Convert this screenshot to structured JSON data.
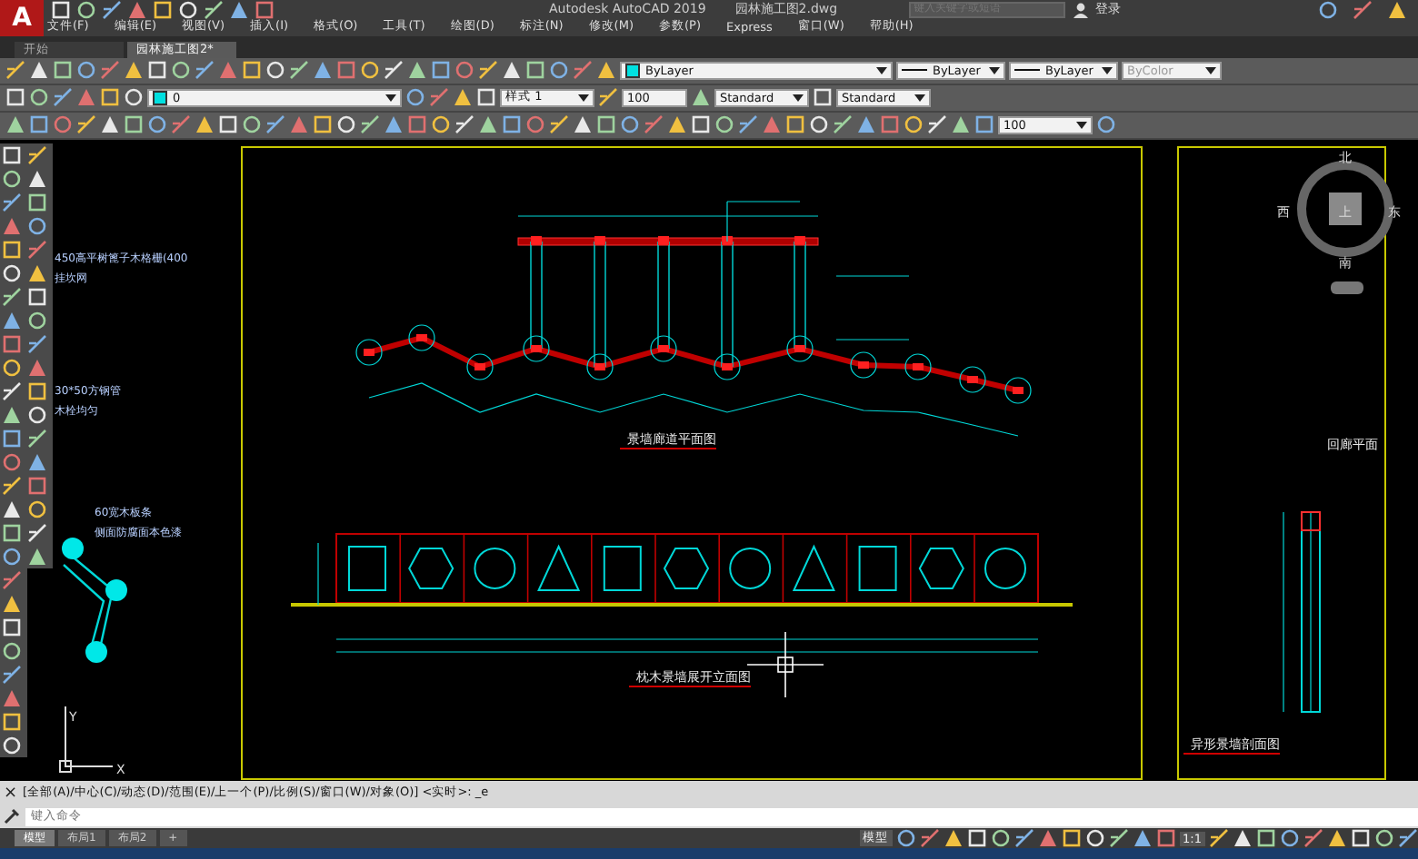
{
  "window": {
    "app_logo": "A",
    "title": "Autodesk AutoCAD 2019",
    "file": "园林施工图2.dwg",
    "search": {
      "placeholder": "键入关键字或短语"
    },
    "sign_in": "登录"
  },
  "menu": [
    "文件(F)",
    "编辑(E)",
    "视图(V)",
    "插入(I)",
    "格式(O)",
    "工具(T)",
    "绘图(D)",
    "标注(N)",
    "修改(M)",
    "参数(P)",
    "Express",
    "窗口(W)",
    "帮助(H)"
  ],
  "doc_tabs": [
    {
      "label": "开始",
      "selected": false
    },
    {
      "label": "园林施工图2*",
      "selected": true
    }
  ],
  "properties_toolbar": {
    "color_setting": "ByLayer",
    "linetype": "ByLayer",
    "lineweight": "ByLayer",
    "plot_style": "ByColor"
  },
  "layer_toolbar": {
    "layer": "0",
    "text_style": "样式 1",
    "dim_scale": "100",
    "table_style": "Standard",
    "multileader_style": "Standard"
  },
  "annotation_toolbar": {
    "scale": "100"
  },
  "drawing": {
    "titles": [
      {
        "text": "景墙廊道平面图",
        "kind": "plan"
      },
      {
        "text": "枕木景墙展开立面图",
        "kind": "elevation"
      },
      {
        "text": "异形景墙剖面图",
        "kind": "section"
      },
      {
        "text": "回廊平面",
        "kind": "edge"
      }
    ],
    "notes": [
      "450高平树篦子木格栅(400",
      "挂坎网",
      "30*50方钢管",
      "木栓均匀",
      "60宽木板条",
      "侧面防腐面本色漆"
    ],
    "compass": {
      "north": "北",
      "west": "西",
      "east": "东",
      "south": "南",
      "top": "上"
    },
    "ucs": {
      "x": "X",
      "y": "Y"
    }
  },
  "command_line": {
    "close": "×",
    "history": "[全部(A)/中心(C)/动态(D)/范围(E)/上一个(P)/比例(S)/窗口(W)/对象(O)] <实时>: _e",
    "placeholder": "键入命令"
  },
  "layout_tabs": [
    {
      "label": "模型",
      "selected": true
    },
    {
      "label": "布局1",
      "selected": false
    },
    {
      "label": "布局2",
      "selected": false
    }
  ],
  "add_layout": "+",
  "status_bar": {
    "space": "模型",
    "scale": "1:1"
  }
}
